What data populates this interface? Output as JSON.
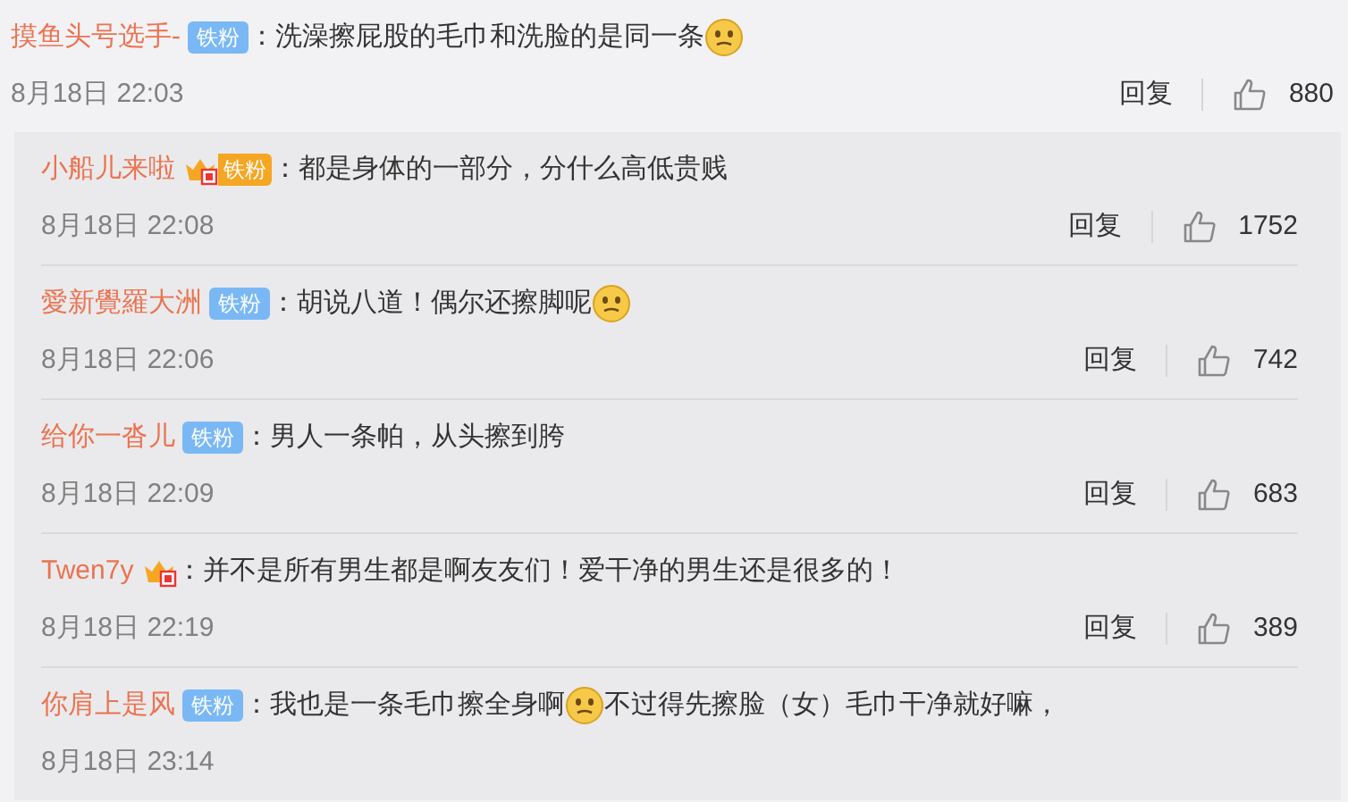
{
  "comment": {
    "user": "摸鱼头号选手-",
    "badges": [
      {
        "kind": "fan",
        "label": "铁粉"
      }
    ],
    "segments": [
      {
        "kind": "text",
        "text": "：洗澡擦屁股的毛巾和洗脸的是同一条"
      },
      {
        "kind": "emoji"
      }
    ],
    "time": "8月18日 22:03",
    "reply": "回复",
    "likes": "880"
  },
  "replies": [
    {
      "user": "小船儿来啦",
      "badges": [
        {
          "kind": "crown-fan",
          "label": "铁粉"
        }
      ],
      "segments": [
        {
          "kind": "text",
          "text": "：都是身体的一部分，分什么高低贵贱"
        }
      ],
      "time": "8月18日 22:08",
      "reply": "回复",
      "likes": "1752"
    },
    {
      "user": "愛新覺羅大洲",
      "badges": [
        {
          "kind": "fan",
          "label": "铁粉"
        }
      ],
      "segments": [
        {
          "kind": "text",
          "text": "：胡说八道！偶尔还擦脚呢"
        },
        {
          "kind": "emoji"
        }
      ],
      "time": "8月18日 22:06",
      "reply": "回复",
      "likes": "742"
    },
    {
      "user": "给你一沓儿",
      "badges": [
        {
          "kind": "fan",
          "label": "铁粉"
        }
      ],
      "segments": [
        {
          "kind": "text",
          "text": "：男人一条帕，从头擦到胯"
        }
      ],
      "time": "8月18日 22:09",
      "reply": "回复",
      "likes": "683"
    },
    {
      "user": "Twen7y",
      "badges": [
        {
          "kind": "crown"
        }
      ],
      "segments": [
        {
          "kind": "text",
          "text": "：并不是所有男生都是啊友友们！爱干净的男生还是很多的！"
        }
      ],
      "time": "8月18日 22:19",
      "reply": "回复",
      "likes": "389"
    },
    {
      "user": "你肩上是风",
      "badges": [
        {
          "kind": "fan",
          "label": "铁粉"
        }
      ],
      "segments": [
        {
          "kind": "text",
          "text": "：我也是一条毛巾擦全身啊"
        },
        {
          "kind": "emoji"
        },
        {
          "kind": "text",
          "text": "不过得先擦脸（女）毛巾干净就好嘛，"
        }
      ],
      "time": "8月18日 23:14"
    }
  ]
}
